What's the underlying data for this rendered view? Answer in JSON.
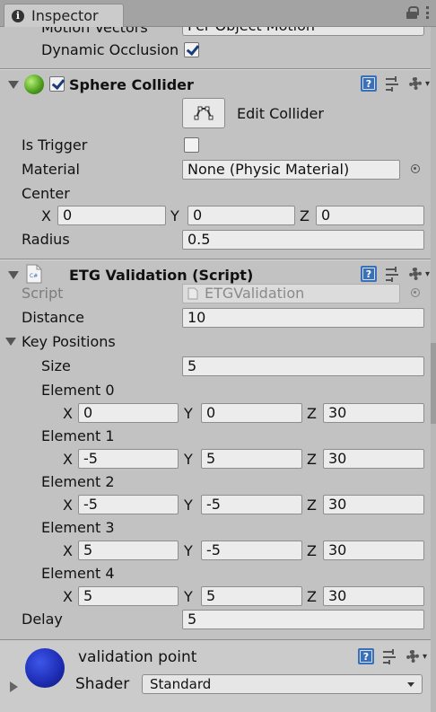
{
  "window": {
    "tab_label": "Inspector"
  },
  "top_partial": {
    "motion_vectors_label": "Motion Vectors",
    "motion_vectors_value": "Per Object Motion",
    "dynamic_occlusion_label": "Dynamic Occlusion",
    "dynamic_occlusion_checked": true
  },
  "sphere_collider": {
    "title": "Sphere Collider",
    "enabled": true,
    "edit_collider_label": "Edit Collider",
    "is_trigger_label": "Is Trigger",
    "is_trigger_checked": false,
    "material_label": "Material",
    "material_value": "None (Physic Material)",
    "center_label": "Center",
    "center": {
      "x_label": "X",
      "x": "0",
      "y_label": "Y",
      "y": "0",
      "z_label": "Z",
      "z": "0"
    },
    "radius_label": "Radius",
    "radius": "0.5"
  },
  "etg_validation": {
    "title": "ETG Validation (Script)",
    "script_label": "Script",
    "script_value": "ETGValidation",
    "distance_label": "Distance",
    "distance": "10",
    "key_positions_label": "Key Positions",
    "size_label": "Size",
    "size": "5",
    "elements": [
      {
        "label": "Element 0",
        "x": "0",
        "y": "0",
        "z": "30"
      },
      {
        "label": "Element 1",
        "x": "-5",
        "y": "5",
        "z": "30"
      },
      {
        "label": "Element 2",
        "x": "-5",
        "y": "-5",
        "z": "30"
      },
      {
        "label": "Element 3",
        "x": "5",
        "y": "-5",
        "z": "30"
      },
      {
        "label": "Element 4",
        "x": "5",
        "y": "5",
        "z": "30"
      }
    ],
    "axis": {
      "x": "X",
      "y": "Y",
      "z": "Z"
    },
    "delay_label": "Delay",
    "delay": "5"
  },
  "material": {
    "name": "validation point",
    "shader_label": "Shader",
    "shader_value": "Standard",
    "sphere_color": "#1f2fb8"
  },
  "icons": [
    "info-icon",
    "lock-icon",
    "more-menu-icon",
    "fold-arrow-icon",
    "sphere-collider-icon",
    "script-icon",
    "help-icon",
    "preset-icon",
    "gear-icon",
    "edit-collider-icon",
    "object-picker-icon"
  ]
}
